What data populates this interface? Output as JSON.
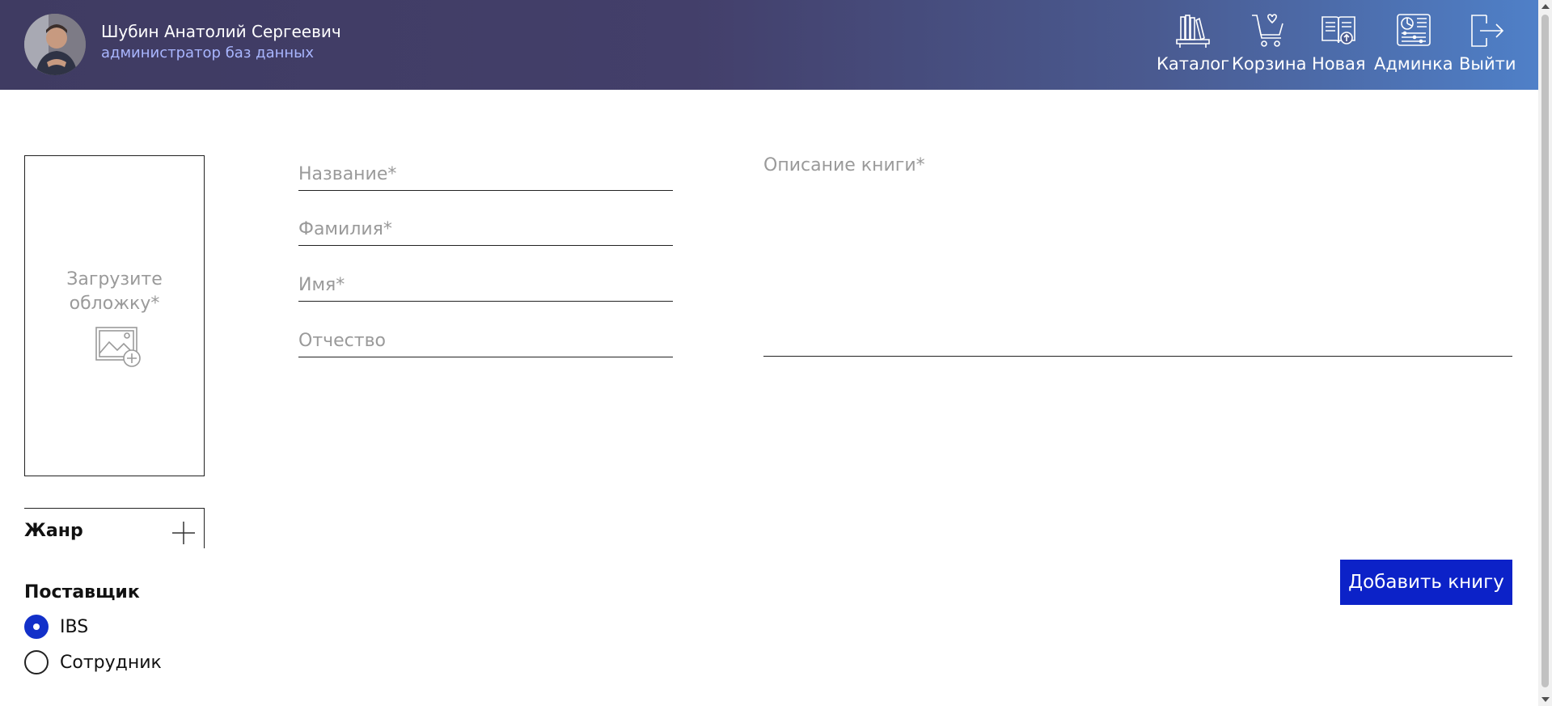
{
  "user": {
    "name": "Шубин Анатолий Сергеевич",
    "role": "администратор баз данных"
  },
  "nav": [
    {
      "label": "Каталог",
      "icon": "bookshelf-icon"
    },
    {
      "label": "Корзина",
      "icon": "cart-heart-icon"
    },
    {
      "label": "Новая",
      "icon": "new-book-icon"
    },
    {
      "label": "Админка",
      "icon": "admin-dashboard-icon"
    },
    {
      "label": "Выйти",
      "icon": "logout-icon"
    }
  ],
  "form": {
    "cover_label": "Загрузите обложку*",
    "title_placeholder": "Название*",
    "lastname_placeholder": "Фамилия*",
    "firstname_placeholder": "Имя*",
    "patronymic_placeholder": "Отчество",
    "description_placeholder": "Описание книги*",
    "genre_label": "Жанр",
    "supplier_label": "Поставщик",
    "supplier_options": [
      {
        "label": "IBS",
        "checked": true
      },
      {
        "label": "Сотрудник",
        "checked": false
      }
    ],
    "submit_label": "Добавить книгу"
  },
  "colors": {
    "accent": "#0c22c8",
    "header_start": "#3f3b62",
    "header_end": "#4f80c8",
    "role_text": "#a9b6ff"
  }
}
